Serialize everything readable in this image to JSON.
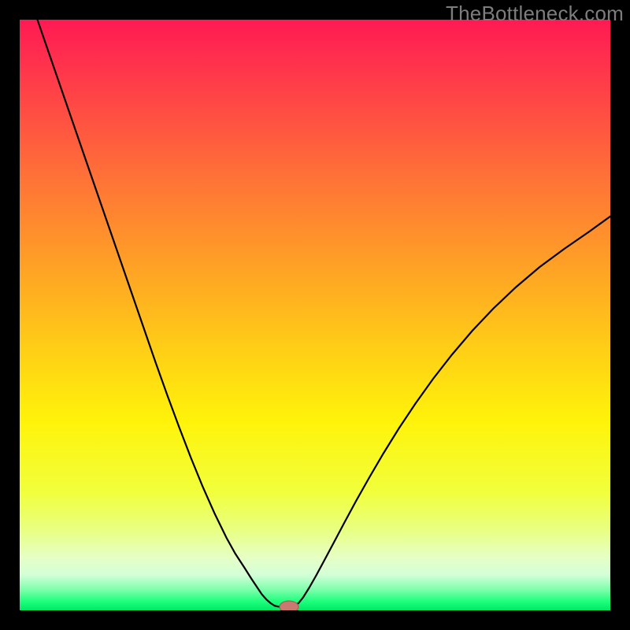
{
  "watermark": "TheBottleneck.com",
  "colors": {
    "frame": "#000000",
    "line": "#000000",
    "marker_fill": "#c97970",
    "marker_stroke": "#a85c54"
  },
  "chart_data": {
    "type": "line",
    "title": "",
    "xlabel": "",
    "ylabel": "",
    "xlim": [
      0,
      100
    ],
    "ylim": [
      0,
      100
    ],
    "gradient_stops": [
      {
        "offset": 0.0,
        "color": "#ff1a52"
      },
      {
        "offset": 0.05,
        "color": "#ff2a4f"
      },
      {
        "offset": 0.15,
        "color": "#ff4b44"
      },
      {
        "offset": 0.28,
        "color": "#ff7636"
      },
      {
        "offset": 0.42,
        "color": "#ffa225"
      },
      {
        "offset": 0.56,
        "color": "#ffcf16"
      },
      {
        "offset": 0.68,
        "color": "#fff30a"
      },
      {
        "offset": 0.8,
        "color": "#f1ff3c"
      },
      {
        "offset": 0.86,
        "color": "#e9ff7d"
      },
      {
        "offset": 0.91,
        "color": "#e6ffc4"
      },
      {
        "offset": 0.94,
        "color": "#d3ffd8"
      },
      {
        "offset": 0.965,
        "color": "#7dffab"
      },
      {
        "offset": 0.985,
        "color": "#1cff7c"
      },
      {
        "offset": 1.0,
        "color": "#00e865"
      }
    ],
    "series": [
      {
        "name": "left-branch",
        "x": [
          3,
          5,
          7,
          9,
          11,
          13,
          15,
          17,
          19,
          21,
          23,
          25,
          27,
          29,
          31,
          33,
          35,
          36.5,
          38,
          39.2,
          40.2,
          41,
          41.8,
          42.5
        ],
        "y": [
          100,
          94.2,
          88.4,
          82.6,
          76.8,
          71.0,
          65.2,
          59.4,
          53.6,
          47.8,
          42.0,
          36.4,
          31.0,
          25.8,
          20.9,
          16.4,
          12.3,
          9.6,
          7.3,
          5.4,
          3.9,
          2.7,
          1.8,
          1.2
        ]
      },
      {
        "name": "right-branch",
        "x": [
          47.2,
          48,
          49,
          50.2,
          51.6,
          53.2,
          55,
          57,
          59.2,
          61.6,
          64.2,
          67,
          70,
          73.2,
          76.6,
          80.2,
          84,
          88,
          92.2,
          96.4,
          100
        ],
        "y": [
          1.2,
          2.2,
          3.8,
          5.9,
          8.5,
          11.5,
          14.9,
          18.6,
          22.5,
          26.6,
          30.8,
          35.0,
          39.2,
          43.3,
          47.3,
          51.1,
          54.7,
          58.1,
          61.2,
          64.1,
          66.7
        ]
      },
      {
        "name": "valley-floor",
        "x": [
          42.5,
          43.2,
          44.2,
          45.4,
          46.3,
          47.2
        ],
        "y": [
          1.2,
          0.75,
          0.55,
          0.55,
          0.75,
          1.2
        ]
      }
    ],
    "marker": {
      "x": 45.6,
      "y": 0.6,
      "rx": 1.6,
      "ry": 1.0
    }
  }
}
